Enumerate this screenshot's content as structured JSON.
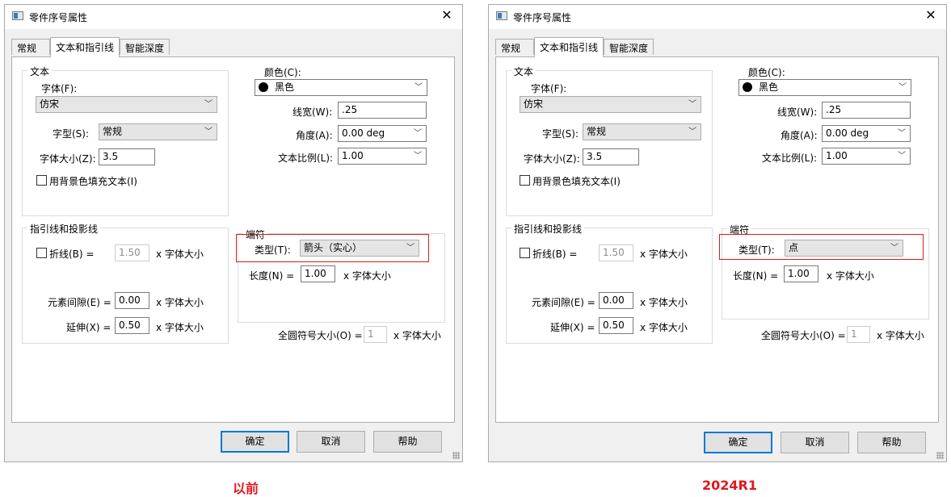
{
  "dialogs": [
    {
      "title": "零件序号属性",
      "tabs": [
        "常规",
        "文本和指引线",
        "智能深度"
      ],
      "text_group": {
        "label": "文本",
        "font_label": "字体(F):",
        "font_value": "仿宋",
        "style_label": "字型(S):",
        "style_value": "常规",
        "size_label": "字体大小(Z):",
        "size_value": "3.5",
        "fill_label": "用背景色填充文本(I)"
      },
      "right": {
        "color_label": "颜色(C):",
        "color_value": "黑色",
        "linewidth_label": "线宽(W):",
        "linewidth_value": ".25",
        "angle_label": "角度(A):",
        "angle_value": "0.00 deg",
        "ratio_label": "文本比例(L):",
        "ratio_value": "1.00"
      },
      "leader_group": {
        "label": "指引线和投影线",
        "fold_label": "折线(B) =",
        "fold_value": "1.50",
        "fold_unit": "x 字体大小",
        "gap_label": "元素间隙(E) =",
        "gap_value": "0.00",
        "gap_unit": "x 字体大小",
        "extend_label": "延伸(X) =",
        "extend_value": "0.50",
        "extend_unit": "x 字体大小"
      },
      "terminator_group": {
        "label": "端符",
        "type_label": "类型(T):",
        "type_value": "箭头（实心）",
        "length_label": "长度(N) =",
        "length_value": "1.00",
        "length_unit": "x 字体大小"
      },
      "circle_label": "全圆符号大小(O) =",
      "circle_value": "1",
      "circle_unit": "x 字体大小",
      "buttons": {
        "ok": "确定",
        "cancel": "取消",
        "help": "帮助"
      },
      "caption": "以前"
    },
    {
      "title": "零件序号属性",
      "tabs": [
        "常规",
        "文本和指引线",
        "智能深度"
      ],
      "text_group": {
        "label": "文本",
        "font_label": "字体(F):",
        "font_value": "仿宋",
        "style_label": "字型(S):",
        "style_value": "常规",
        "size_label": "字体大小(Z):",
        "size_value": "3.5",
        "fill_label": "用背景色填充文本(I)"
      },
      "right": {
        "color_label": "颜色(C):",
        "color_value": "黑色",
        "linewidth_label": "线宽(W):",
        "linewidth_value": ".25",
        "angle_label": "角度(A):",
        "angle_value": "0.00 deg",
        "ratio_label": "文本比例(L):",
        "ratio_value": "1.00"
      },
      "leader_group": {
        "label": "指引线和投影线",
        "fold_label": "折线(B) =",
        "fold_value": "1.50",
        "fold_unit": "x 字体大小",
        "gap_label": "元素间隙(E) =",
        "gap_value": "0.00",
        "gap_unit": "x 字体大小",
        "extend_label": "延伸(X) =",
        "extend_value": "0.50",
        "extend_unit": "x 字体大小"
      },
      "terminator_group": {
        "label": "端符",
        "type_label": "类型(T):",
        "type_value": "点",
        "length_label": "长度(N) =",
        "length_value": "1.00",
        "length_unit": "x 字体大小"
      },
      "circle_label": "全圆符号大小(O) =",
      "circle_value": "1",
      "circle_unit": "x 字体大小",
      "buttons": {
        "ok": "确定",
        "cancel": "取消",
        "help": "帮助"
      },
      "caption": "2024R1"
    }
  ],
  "colors": {
    "highlight_box": "#d21e1e",
    "caption": "#e0181d",
    "default_button_border": "#0078d7"
  },
  "icons": {
    "close": "close-icon",
    "dropdown": "chevron-down-icon",
    "app": "app-window-icon",
    "color_swatch": "color-dot-icon"
  }
}
